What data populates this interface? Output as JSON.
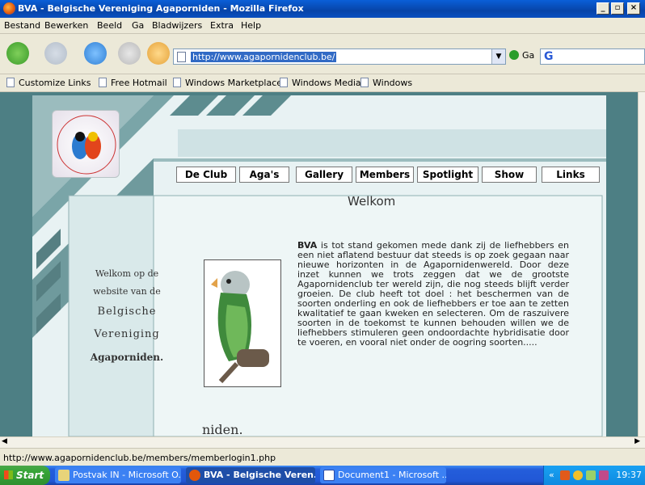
{
  "window": {
    "title": "BVA - Belgische Vereniging Agaporniden - Mozilla Firefox"
  },
  "menu": [
    "Bestand",
    "Bewerken",
    "Beeld",
    "Ga",
    "Bladwijzers",
    "Extra",
    "Help"
  ],
  "nav": {
    "url": "http://www.agapornidenclub.be/",
    "go_label": "Ga"
  },
  "bookmarks": [
    "Customize Links",
    "Free Hotmail",
    "Windows Marketplace",
    "Windows Media",
    "Windows"
  ],
  "site": {
    "logo_text": "Belgische Vereniging Agaporniden",
    "tabs": [
      "De Club",
      "Aga's",
      "Gallery",
      "Members",
      "Spotlight",
      "Show",
      "Links"
    ],
    "heading": "Welkom",
    "side_line1": "Welkom op de",
    "side_line2": "website van de",
    "side_line3": "Belgische",
    "side_line4": "Vereniging",
    "side_line5": "Agaporniden.",
    "body_bold": "BVA",
    "body_text": " is tot stand gekomen mede dank zij de liefhebbers en een niet aflatend bestuur dat steeds is op zoek gegaan naar nieuwe horizonten in de Agapornidenwereld. Door deze inzet kunnen we trots zeggen dat we de grootste Agapornidenclub ter wereld zijn, die nog steeds blijft verder groeien. De club heeft tot doel : het beschermen van de soorten onderling en ook de liefhebbers er toe aan te zetten kwalitatief te gaan kweken en selecteren. Om de raszuivere soorten in de toekomst te kunnen behouden willen we de liefhebbers stimuleren geen ondoordachte hybridisatie door te voeren, en vooral niet onder de oogring soorten.....",
    "footer_fragment": "niden."
  },
  "status": {
    "text": "http://www.agapornidenclub.be/members/memberlogin1.php"
  },
  "taskbar": {
    "start": "Start",
    "tasks": [
      "Postvak IN - Microsoft O...",
      "BVA - Belgische Veren...",
      "Document1 - Microsoft ..."
    ],
    "clock": "19:37"
  }
}
